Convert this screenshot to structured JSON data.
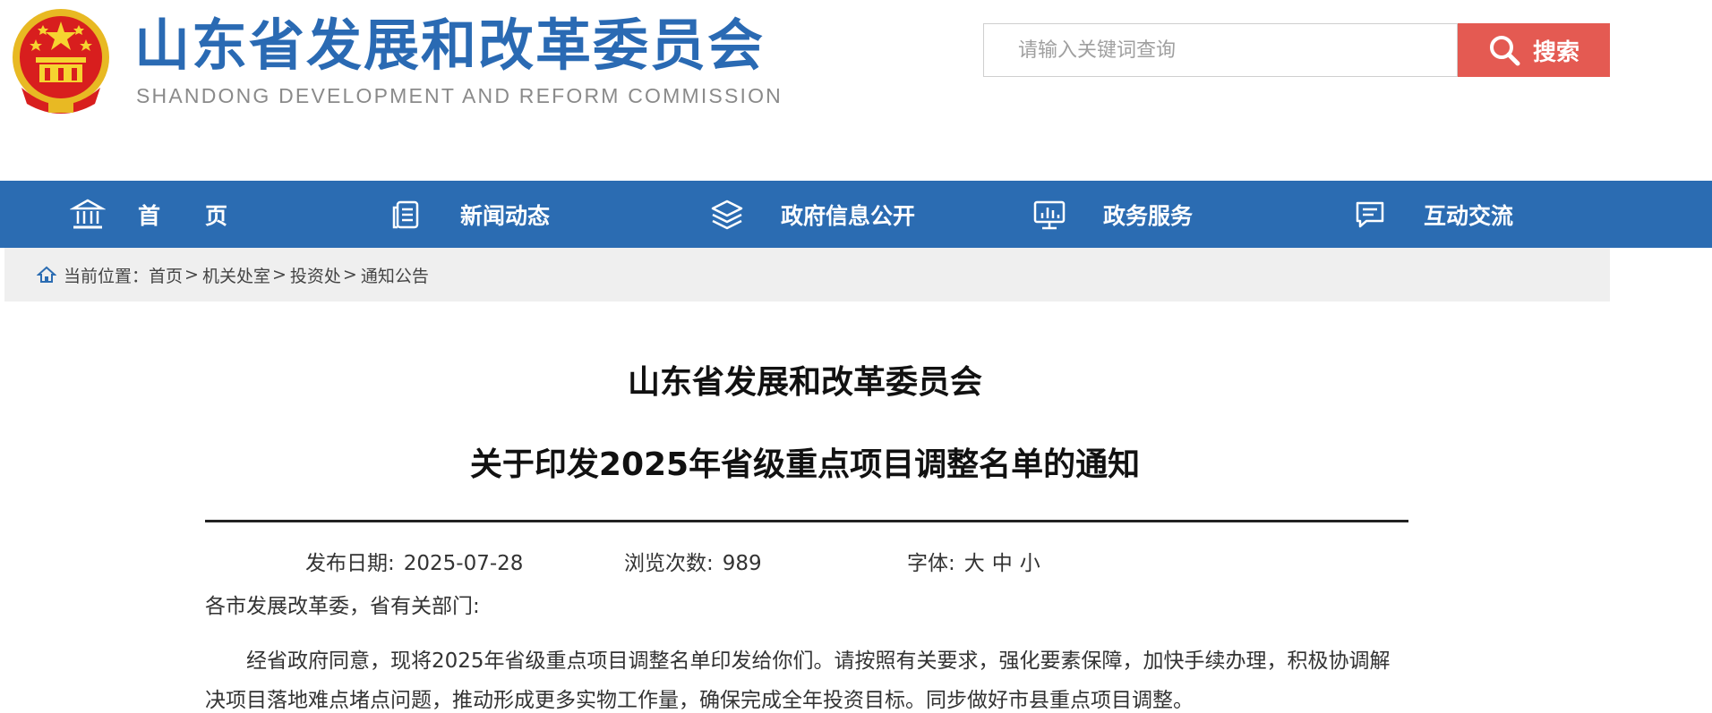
{
  "header": {
    "site_title": "山东省发展和改革委员会",
    "site_subtitle": "SHANDONG DEVELOPMENT AND REFORM COMMISSION",
    "search": {
      "placeholder": "请输入关键词查询",
      "value": "",
      "button_label": "搜索"
    },
    "colors": {
      "title": "#2a6ab3",
      "search_button": "#e45a52"
    }
  },
  "nav": {
    "background": "#2b6cb2",
    "items": [
      {
        "label": "首　　页",
        "icon": "bank-icon"
      },
      {
        "label": "新闻动态",
        "icon": "document-list-icon"
      },
      {
        "label": "政府信息公开",
        "icon": "layers-icon"
      },
      {
        "label": "政务服务",
        "icon": "monitor-chart-icon"
      },
      {
        "label": "互动交流",
        "icon": "chat-bubble-icon"
      }
    ]
  },
  "breadcrumb": {
    "prefix": "当前位置：",
    "items": [
      "首页",
      "机关处室",
      "投资处",
      "通知公告"
    ],
    "separator": ">"
  },
  "article": {
    "title_line1": "山东省发展和改革委员会",
    "title_line2": "关于印发2025年省级重点项目调整名单的通知",
    "meta": {
      "date_label": "发布日期:",
      "date_value": "2025-07-28",
      "views_label": "浏览次数:",
      "views_value": "989",
      "font_label": "字体:",
      "font_options": [
        "大",
        "中",
        "小"
      ]
    },
    "salutation": "各市发展改革委，省有关部门:",
    "paragraph": "经省政府同意，现将2025年省级重点项目调整名单印发给你们。请按照有关要求，强化要素保障，加快手续办理，积极协调解决项目落地难点堵点问题，推动形成更多实物工作量，确保完成全年投资目标。同步做好市县重点项目调整。"
  }
}
